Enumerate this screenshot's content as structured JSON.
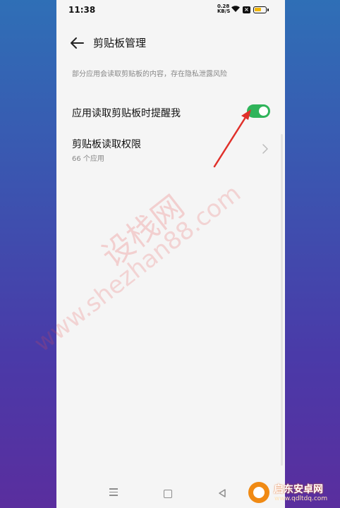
{
  "status_bar": {
    "time": "11:38",
    "net_speed_value": "0.28",
    "net_speed_unit": "KB/S",
    "battery_color": "#f2b600"
  },
  "header": {
    "title": "剪贴板管理"
  },
  "description": "部分应用会读取剪贴板的内容，存在隐私泄露风险",
  "settings": {
    "notify": {
      "label": "应用读取剪贴板时提醒我",
      "enabled": true,
      "toggle_color": "#2fb45a"
    },
    "permission": {
      "label": "剪贴板读取权限",
      "subtitle": "66 个应用"
    }
  },
  "watermark": {
    "text_cn": "设栈网",
    "text_url": "www.shezhan88.com",
    "color": "#e84a4a"
  },
  "annotation": {
    "arrow_color": "#e0302a"
  },
  "nav": {
    "menu_icon": "menu-icon",
    "home_icon": "home-icon",
    "back_icon": "back-triangle-icon"
  },
  "logo": {
    "name": "启东安卓网",
    "url": "www.qdltdq.com",
    "color": "#f08a14"
  }
}
